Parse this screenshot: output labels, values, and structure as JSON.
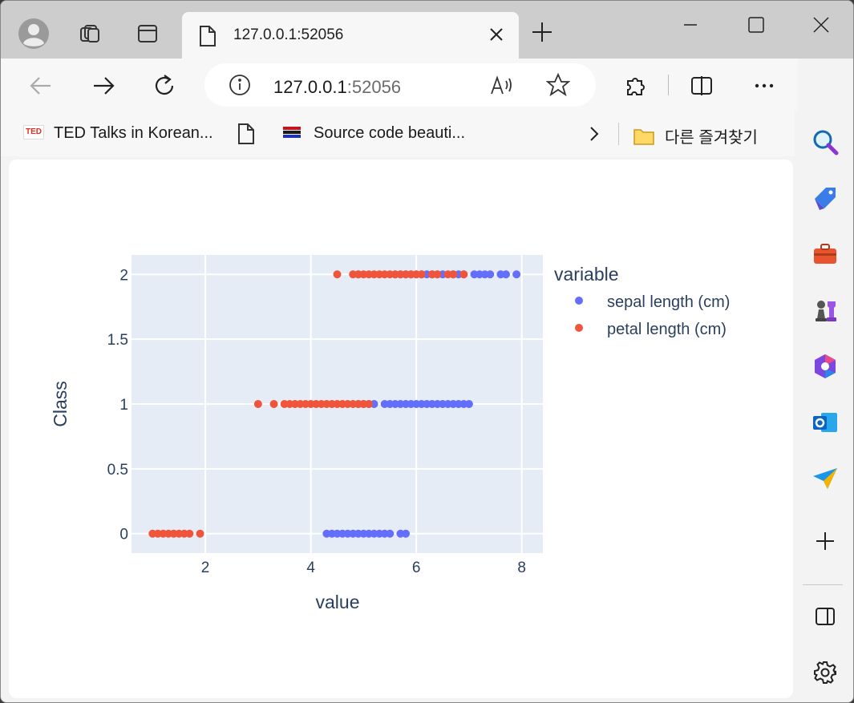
{
  "browser": {
    "tab_title": "127.0.0.1:52056",
    "address": {
      "host_main": "127.0.0.1",
      "host_port": ":52056"
    },
    "bookmarks": [
      {
        "label": "TED Talks in Korean...",
        "icon": "ted-logo-icon"
      },
      {
        "label": "",
        "icon": "document-icon"
      },
      {
        "label": "Source code beauti...",
        "icon": "flag-lines-icon"
      }
    ],
    "other_favorites": "다른 즐겨찾기",
    "ted_logo_text": "TED"
  },
  "colors": {
    "sepal": "#636efa",
    "petal": "#ef553b",
    "plot_bg": "#e5ecf6",
    "axis_text": "#2a3f5f"
  },
  "chart_data": {
    "type": "scatter",
    "xlabel": "value",
    "ylabel": "Class",
    "xlim": [
      0.6,
      8.4
    ],
    "ylim": [
      -0.15,
      2.15
    ],
    "xticks": [
      2,
      4,
      6,
      8
    ],
    "yticks": [
      0,
      0.5,
      1,
      1.5,
      2
    ],
    "ytick_labels": [
      "0",
      "0.5",
      "1",
      "1.5",
      "2"
    ],
    "legend_title": "variable",
    "legend_position": "right",
    "grid": true,
    "series": [
      {
        "name": "sepal length (cm)",
        "points": [
          [
            4.3,
            0
          ],
          [
            4.4,
            0
          ],
          [
            4.5,
            0
          ],
          [
            4.6,
            0
          ],
          [
            4.7,
            0
          ],
          [
            4.8,
            0
          ],
          [
            4.9,
            0
          ],
          [
            5.0,
            0
          ],
          [
            5.1,
            0
          ],
          [
            5.2,
            0
          ],
          [
            5.3,
            0
          ],
          [
            5.4,
            0
          ],
          [
            5.5,
            0
          ],
          [
            5.7,
            0
          ],
          [
            5.8,
            0
          ],
          [
            4.9,
            1
          ],
          [
            5.0,
            1
          ],
          [
            5.1,
            1
          ],
          [
            5.2,
            1
          ],
          [
            5.4,
            1
          ],
          [
            5.5,
            1
          ],
          [
            5.6,
            1
          ],
          [
            5.7,
            1
          ],
          [
            5.8,
            1
          ],
          [
            5.9,
            1
          ],
          [
            6.0,
            1
          ],
          [
            6.1,
            1
          ],
          [
            6.2,
            1
          ],
          [
            6.3,
            1
          ],
          [
            6.4,
            1
          ],
          [
            6.5,
            1
          ],
          [
            6.6,
            1
          ],
          [
            6.7,
            1
          ],
          [
            6.8,
            1
          ],
          [
            6.9,
            1
          ],
          [
            7.0,
            1
          ],
          [
            4.9,
            2
          ],
          [
            5.6,
            2
          ],
          [
            5.7,
            2
          ],
          [
            5.8,
            2
          ],
          [
            5.9,
            2
          ],
          [
            6.0,
            2
          ],
          [
            6.1,
            2
          ],
          [
            6.2,
            2
          ],
          [
            6.3,
            2
          ],
          [
            6.4,
            2
          ],
          [
            6.5,
            2
          ],
          [
            6.7,
            2
          ],
          [
            6.8,
            2
          ],
          [
            6.9,
            2
          ],
          [
            7.1,
            2
          ],
          [
            7.2,
            2
          ],
          [
            7.3,
            2
          ],
          [
            7.4,
            2
          ],
          [
            7.6,
            2
          ],
          [
            7.7,
            2
          ],
          [
            7.9,
            2
          ]
        ]
      },
      {
        "name": "petal length (cm)",
        "points": [
          [
            1.0,
            0
          ],
          [
            1.1,
            0
          ],
          [
            1.2,
            0
          ],
          [
            1.3,
            0
          ],
          [
            1.4,
            0
          ],
          [
            1.5,
            0
          ],
          [
            1.6,
            0
          ],
          [
            1.7,
            0
          ],
          [
            1.9,
            0
          ],
          [
            3.0,
            1
          ],
          [
            3.3,
            1
          ],
          [
            3.5,
            1
          ],
          [
            3.6,
            1
          ],
          [
            3.7,
            1
          ],
          [
            3.8,
            1
          ],
          [
            3.9,
            1
          ],
          [
            4.0,
            1
          ],
          [
            4.1,
            1
          ],
          [
            4.2,
            1
          ],
          [
            4.3,
            1
          ],
          [
            4.4,
            1
          ],
          [
            4.5,
            1
          ],
          [
            4.6,
            1
          ],
          [
            4.7,
            1
          ],
          [
            4.8,
            1
          ],
          [
            4.9,
            1
          ],
          [
            5.0,
            1
          ],
          [
            5.1,
            1
          ],
          [
            4.5,
            2
          ],
          [
            4.8,
            2
          ],
          [
            4.9,
            2
          ],
          [
            5.0,
            2
          ],
          [
            5.1,
            2
          ],
          [
            5.2,
            2
          ],
          [
            5.3,
            2
          ],
          [
            5.4,
            2
          ],
          [
            5.5,
            2
          ],
          [
            5.6,
            2
          ],
          [
            5.7,
            2
          ],
          [
            5.8,
            2
          ],
          [
            5.9,
            2
          ],
          [
            6.0,
            2
          ],
          [
            6.1,
            2
          ],
          [
            6.3,
            2
          ],
          [
            6.4,
            2
          ],
          [
            6.6,
            2
          ],
          [
            6.7,
            2
          ],
          [
            6.9,
            2
          ]
        ]
      }
    ]
  }
}
